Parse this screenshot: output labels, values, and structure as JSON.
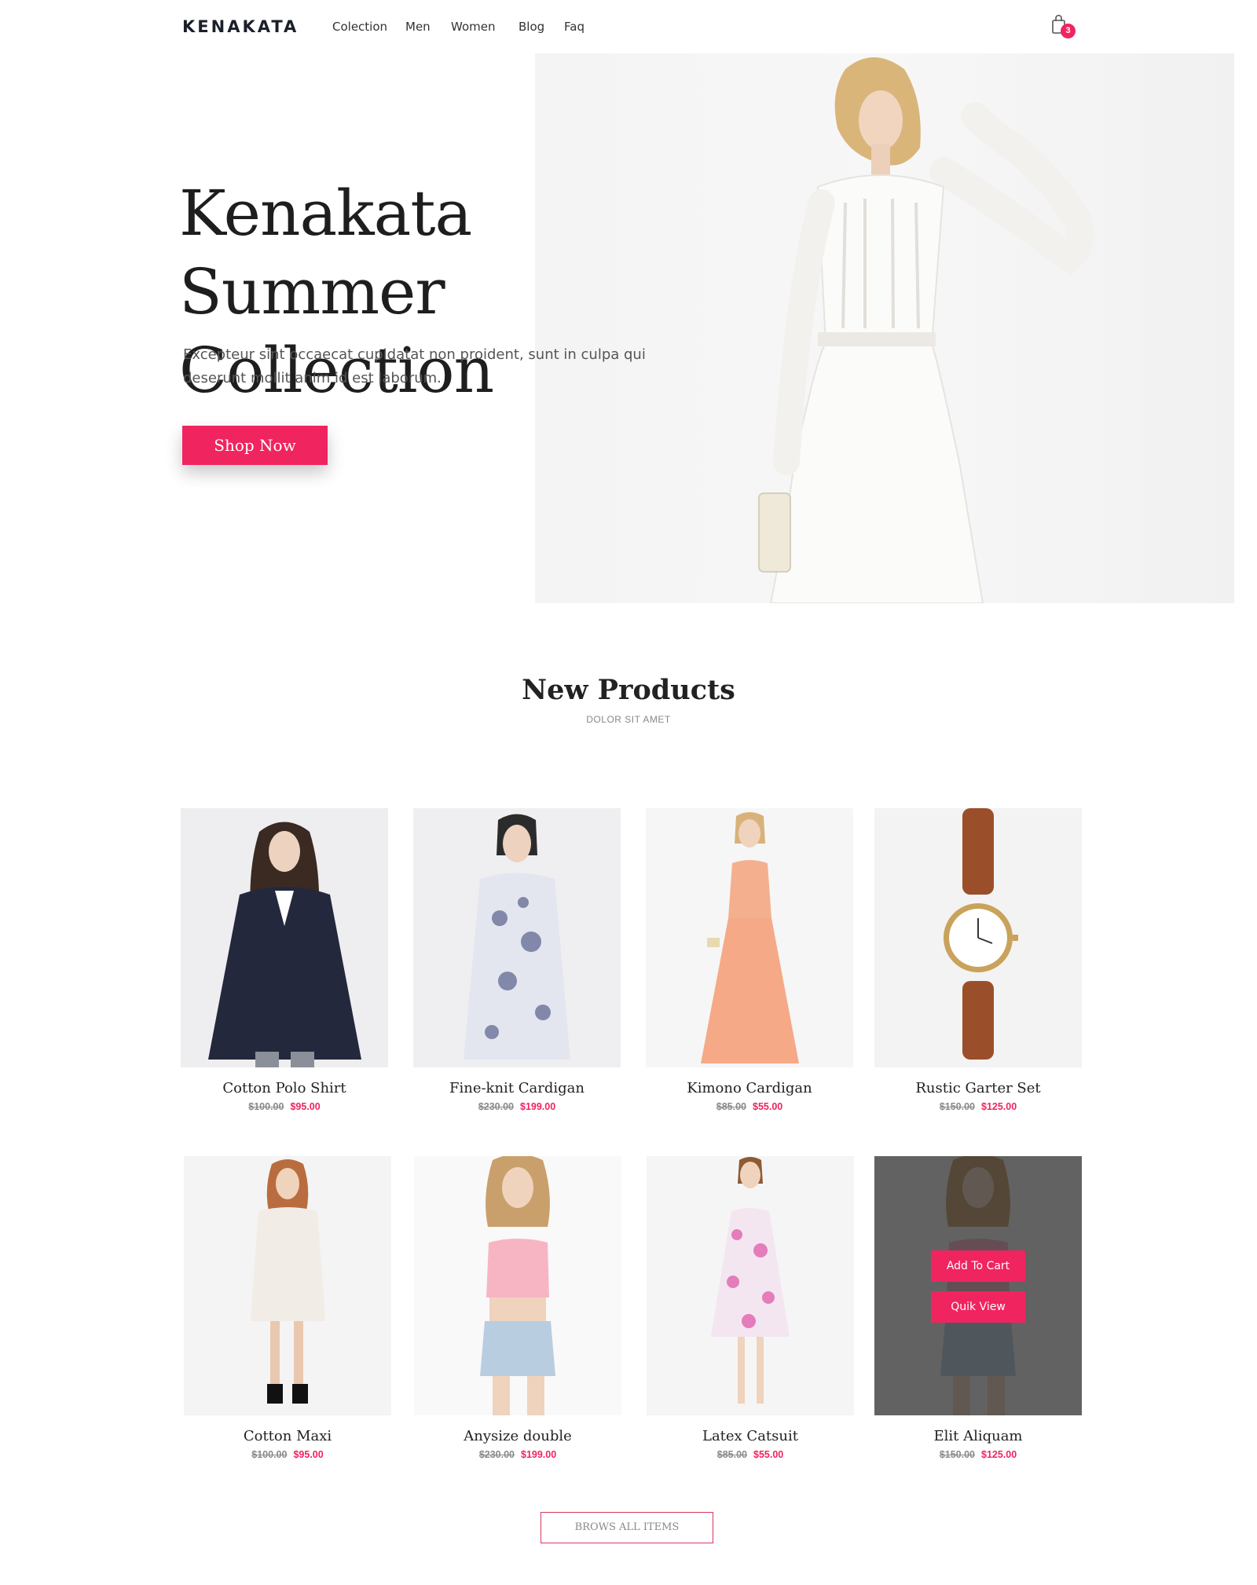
{
  "header": {
    "logo": "KENAKATA",
    "nav": [
      "Colection",
      "Men",
      "Women",
      "Blog",
      "Faq"
    ],
    "cart_count": "3"
  },
  "hero": {
    "title_line1": "Kenakata Summer",
    "title_line2": "Collection",
    "description": "Excepteur sint occaecat cupidatat non proident, sunt in culpa qui deserunt mollit anim id est laborum.",
    "button": "Shop Now"
  },
  "section": {
    "title": "New Products",
    "subtitle": "DOLOR SIT AMET"
  },
  "products": [
    {
      "name": "Cotton Polo Shirt",
      "old_price": "$100.00",
      "price": "$95.00"
    },
    {
      "name": "Fine-knit Cardigan",
      "old_price": "$230.00",
      "price": "$199.00"
    },
    {
      "name": "Kimono Cardigan",
      "old_price": "$85.00",
      "price": "$55.00"
    },
    {
      "name": "Rustic Garter Set",
      "old_price": "$150.00",
      "price": "$125.00"
    },
    {
      "name": "Cotton Maxi",
      "old_price": "$100.00",
      "price": "$95.00"
    },
    {
      "name": "Anysize double",
      "old_price": "$230.00",
      "price": "$199.00"
    },
    {
      "name": "Latex Catsuit",
      "old_price": "$85.00",
      "price": "$55.00"
    },
    {
      "name": "Elit Aliquam",
      "old_price": "$150.00",
      "price": "$125.00"
    }
  ],
  "hover_actions": {
    "add_to_cart": "Add To Cart",
    "quick_view": "Quik View"
  },
  "browse_button": "BROWS ALL ITEMS",
  "colors": {
    "accent": "#f0245f",
    "text_dark": "#1e1e1e",
    "muted": "#8a8a8a"
  }
}
